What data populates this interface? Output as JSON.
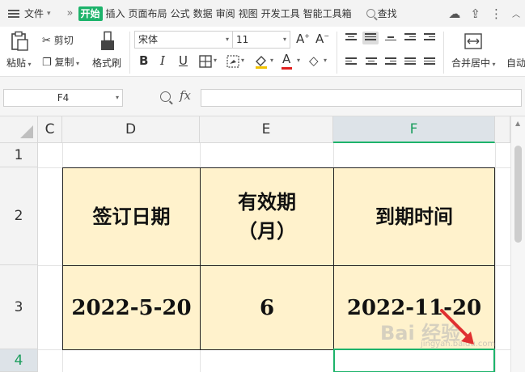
{
  "menubar": {
    "file_label": "文件",
    "more_glyph": "»",
    "tabs": [
      {
        "label": "开始",
        "active": true
      },
      {
        "label": "插入"
      },
      {
        "label": "页面布局"
      },
      {
        "label": "公式"
      },
      {
        "label": "数据"
      },
      {
        "label": "审阅"
      },
      {
        "label": "视图"
      },
      {
        "label": "开发工具"
      },
      {
        "label": "智能工具箱"
      }
    ],
    "search_label": "查找",
    "accent_color": "#1db36b"
  },
  "ribbon": {
    "paste_label": "粘贴",
    "cut_label": "剪切",
    "copy_label": "复制",
    "format_painter_label": "格式刷",
    "font_name": "宋体",
    "font_size": "11",
    "bold": "B",
    "italic": "I",
    "underline": "U",
    "font_color_glyph": "A",
    "font_color": "#e02020",
    "merge_label": "合并居中",
    "auto_label": "自动"
  },
  "formula_bar": {
    "cell_ref": "F4",
    "fx_label": "fx",
    "value": ""
  },
  "sheet": {
    "columns": [
      "C",
      "D",
      "E",
      "F"
    ],
    "selected_column": "F",
    "rows": [
      "1",
      "2",
      "3",
      "4"
    ],
    "selected_row": "4",
    "header_row": {
      "d": "签订日期",
      "e_line1": "有效期",
      "e_line2": "（月）",
      "f": "到期时间"
    },
    "data_row": {
      "d": "2022-5-20",
      "e": "6",
      "f": "2022-11-20"
    },
    "cell_fill": "#fff2cc"
  },
  "overlay": {
    "watermark": "Bai 经验",
    "watermark_sub": "jingyan.baidu.com"
  }
}
